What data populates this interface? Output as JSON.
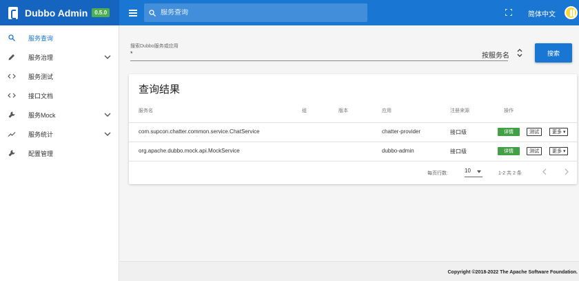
{
  "header": {
    "title": "Dubbo Admin",
    "version": "0.5.0",
    "search_placeholder": "服务查询",
    "language": "简体中文"
  },
  "sidebar": {
    "items": [
      {
        "label": "服务查询",
        "icon": "search-icon",
        "active": true
      },
      {
        "label": "服务治理",
        "icon": "pencil-icon",
        "expandable": true
      },
      {
        "label": "服务测试",
        "icon": "code-icon"
      },
      {
        "label": "接口文档",
        "icon": "code-icon"
      },
      {
        "label": "服务Mock",
        "icon": "wrench-icon",
        "expandable": true
      },
      {
        "label": "服务统计",
        "icon": "chart-icon",
        "expandable": true
      },
      {
        "label": "配置管理",
        "icon": "wrench-icon"
      }
    ]
  },
  "search": {
    "field_label": "搜索Dubbo服务或应用",
    "field_value": "*",
    "type_selected": "按服务名",
    "button_label": "搜索"
  },
  "results": {
    "title": "查询结果",
    "columns": [
      "服务名",
      "组",
      "版本",
      "应用",
      "注册来源",
      "操作"
    ],
    "rows": [
      {
        "service": "com.supcon.chatter.common.service.ChatService",
        "group": "",
        "version": "",
        "application": "chatter-provider",
        "source": "接口级"
      },
      {
        "service": "org.apache.dubbo.mock.api.MockService",
        "group": "",
        "version": "",
        "application": "dubbo-admin",
        "source": "接口级"
      }
    ],
    "actions": {
      "detail": "详情",
      "test": "测试",
      "more": "更多"
    },
    "pagination": {
      "rows_per_page_label": "每页行数:",
      "rows_per_page": "10",
      "range_text": "1-2 共 2 条"
    }
  },
  "footer": {
    "prefix": "Copyright ©2018-2022",
    "org": "The Apache Software Foundation."
  },
  "colors": {
    "primary": "#1976d2",
    "brand_bg": "#1565c0",
    "success": "#43a047",
    "version_badge": "#4caf50"
  }
}
